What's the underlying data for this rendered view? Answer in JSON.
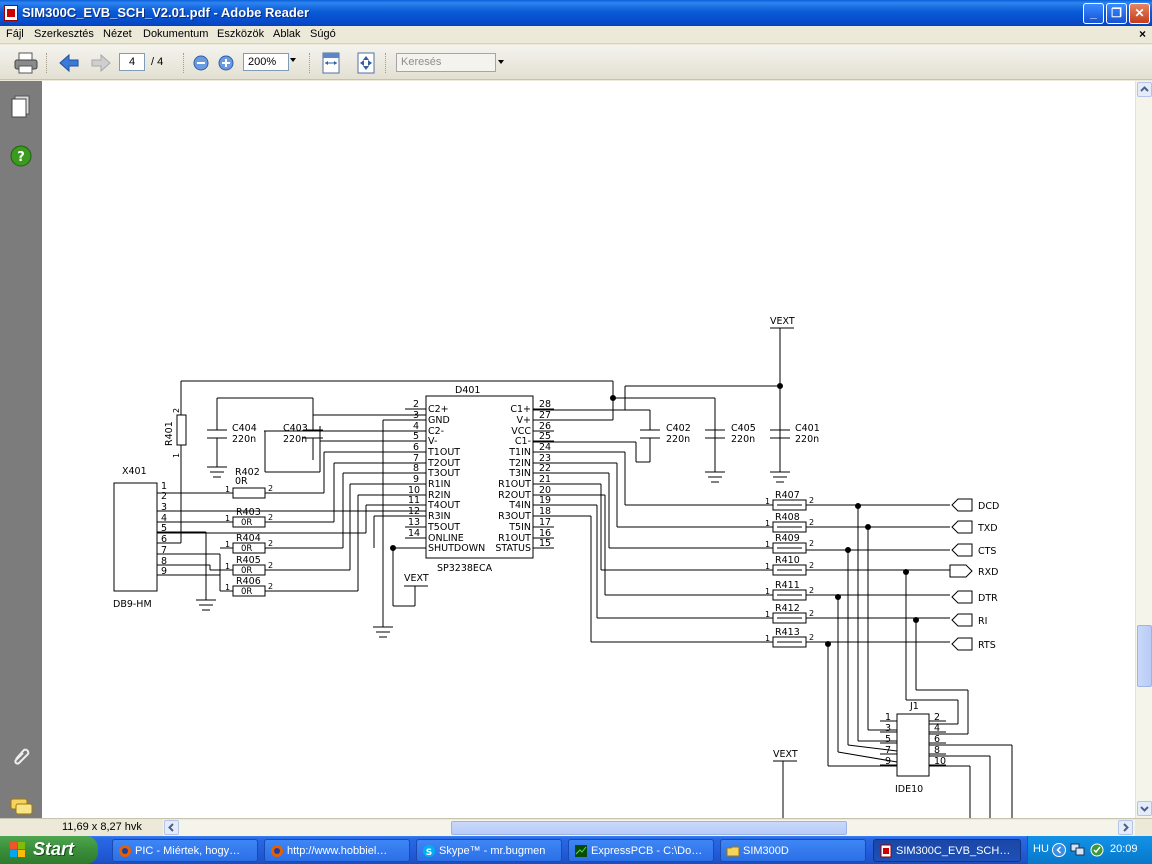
{
  "window": {
    "title": "SIM300C_EVB_SCH_V2.01.pdf - Adobe Reader"
  },
  "menu": {
    "items": [
      "Fájl",
      "Szerkesztés",
      "Nézet",
      "Dokumentum",
      "Eszközök",
      "Ablak",
      "Súgó"
    ]
  },
  "toolbar": {
    "page_value": "4",
    "page_total": "/ 4",
    "zoom_value": "200%",
    "search_placeholder": "Keresés"
  },
  "status": {
    "page_size": "11,69 x 8,27 hvk"
  },
  "taskbar": {
    "start_label": "Start",
    "tasks": [
      "PIC - Miértek, hogy…",
      "http://www.hobbiel…",
      "Skype™ - mr.bugmen",
      "ExpressPCB - C:\\Do…",
      "SIM300D",
      "SIM300C_EVB_SCH…"
    ],
    "tray_lang": "HU",
    "clock": "20:09"
  },
  "schematic": {
    "labels": {
      "vext_top": "VEXT",
      "vext_mid": "VEXT",
      "vext_bot": "VEXT",
      "d401": "D401",
      "ic_name": "SP3238ECA",
      "x401": "X401",
      "db9": "DB9-HM",
      "r401": "R401",
      "r402": "R402",
      "r402_val": "0R",
      "r403": "R403",
      "r404": "R404",
      "r405": "R405",
      "r406": "R406",
      "zero_ohm": "0R",
      "c404": "C404",
      "c403": "C403",
      "c402": "C402",
      "c405": "C405",
      "c401": "C401",
      "cap_val": "220n",
      "r407": "R407",
      "r408": "R408",
      "r409": "R409",
      "r410": "R410",
      "r411": "R411",
      "r412": "R412",
      "r413": "R413",
      "j1": "J1",
      "ide10": "IDE10"
    },
    "left_pins": [
      {
        "num": "2",
        "name": "C2+"
      },
      {
        "num": "3",
        "name": "GND"
      },
      {
        "num": "4",
        "name": "C2-"
      },
      {
        "num": "5",
        "name": "V-"
      },
      {
        "num": "6",
        "name": "T1OUT"
      },
      {
        "num": "7",
        "name": "T2OUT"
      },
      {
        "num": "8",
        "name": "T3OUT"
      },
      {
        "num": "9",
        "name": "R1IN"
      },
      {
        "num": "10",
        "name": "R2IN"
      },
      {
        "num": "11",
        "name": "T4OUT"
      },
      {
        "num": "12",
        "name": "R3IN"
      },
      {
        "num": "13",
        "name": "T5OUT"
      },
      {
        "num": "14",
        "name": "ONLINE"
      },
      {
        "num": "",
        "name": "SHUTDOWN"
      }
    ],
    "right_pins": [
      {
        "num": "28",
        "name": "C1+"
      },
      {
        "num": "27",
        "name": "V+"
      },
      {
        "num": "26",
        "name": "VCC"
      },
      {
        "num": "25",
        "name": "C1-"
      },
      {
        "num": "24",
        "name": "T1IN"
      },
      {
        "num": "23",
        "name": "T2IN"
      },
      {
        "num": "22",
        "name": "T3IN"
      },
      {
        "num": "21",
        "name": "R1OUT"
      },
      {
        "num": "20",
        "name": "R2OUT"
      },
      {
        "num": "19",
        "name": "T4IN"
      },
      {
        "num": "18",
        "name": "R3OUT"
      },
      {
        "num": "17",
        "name": "T5IN"
      },
      {
        "num": "16",
        "name": "R1OUT"
      },
      {
        "num": "15",
        "name": "STATUS"
      }
    ],
    "db9_pins": [
      "1",
      "2",
      "3",
      "4",
      "5",
      "6",
      "7",
      "8",
      "9"
    ],
    "signals": [
      "DCD",
      "TXD",
      "CTS",
      "RXD",
      "DTR",
      "RI",
      "RTS"
    ],
    "j1_left": [
      "1",
      "3",
      "5",
      "7",
      "9"
    ],
    "j1_right": [
      "2",
      "4",
      "6",
      "8",
      "10"
    ],
    "res_pin1": "1",
    "res_pin2": "2"
  }
}
